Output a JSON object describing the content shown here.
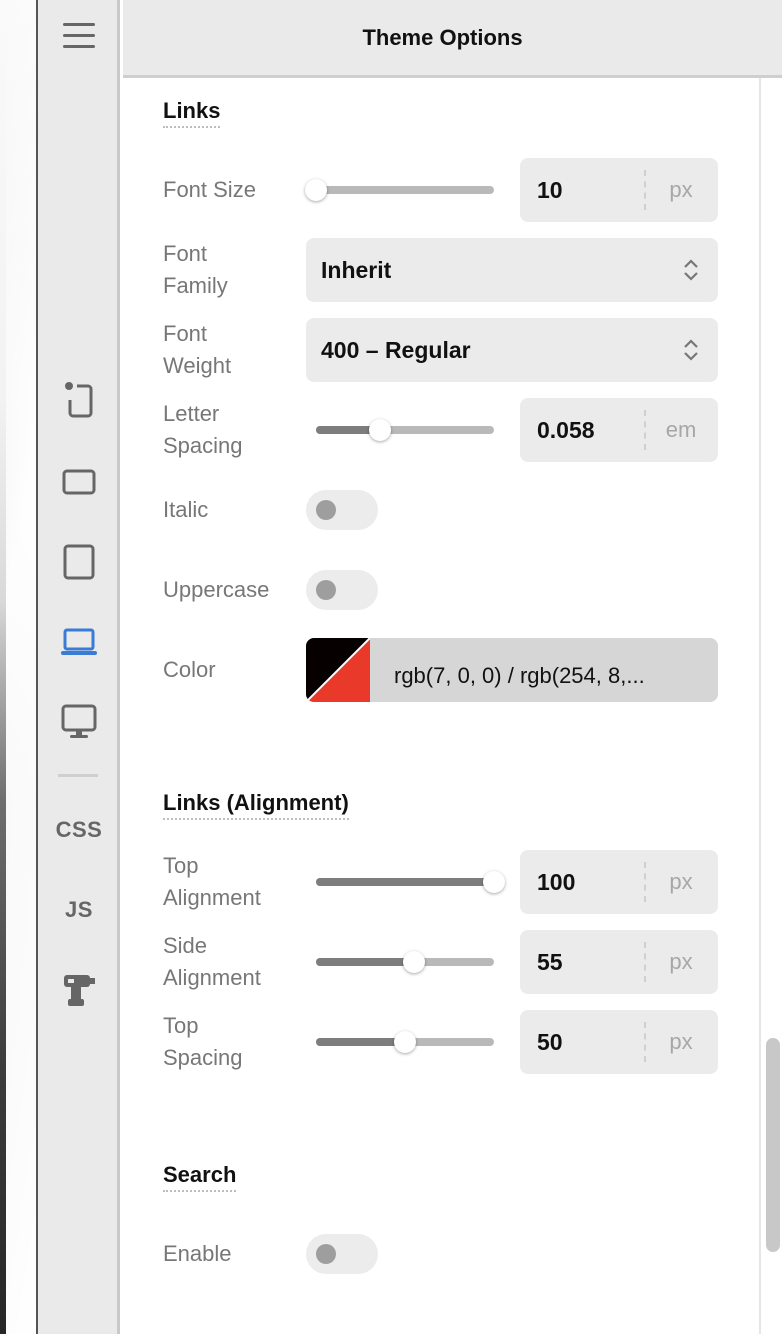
{
  "header": {
    "title": "Theme Options"
  },
  "rail": {
    "menu_icon": "hamburger-menu-icon",
    "items": [
      {
        "name": "mobile-portrait-icon"
      },
      {
        "name": "mobile-landscape-icon"
      },
      {
        "name": "tablet-icon"
      },
      {
        "name": "laptop-icon",
        "active": true
      },
      {
        "name": "desktop-icon"
      }
    ],
    "css_label": "CSS",
    "js_label": "JS",
    "tool_icon": "drill-icon",
    "active_color": "#3a7bd5"
  },
  "links": {
    "title": "Links",
    "font_size": {
      "label": "Font Size",
      "value": "10",
      "unit": "px",
      "level": 0
    },
    "font_family": {
      "label_1": "Font",
      "label_2": "Family",
      "value": "Inherit"
    },
    "font_weight": {
      "label_1": "Font",
      "label_2": "Weight",
      "value": "400 – Regular"
    },
    "letter_spacing": {
      "label_1": "Letter",
      "label_2": "Spacing",
      "value": "0.058",
      "unit": "em",
      "level": 0.36
    },
    "italic": {
      "label": "Italic",
      "on": false
    },
    "uppercase": {
      "label": "Uppercase",
      "on": false
    },
    "color": {
      "label": "Color",
      "value": "rgb(7, 0, 0) / rgb(254, 8,...",
      "swatch_a": "#070000",
      "swatch_b": "#e8392a"
    }
  },
  "alignment": {
    "title": "Links (Alignment)",
    "top_alignment": {
      "label_1": "Top",
      "label_2": "Alignment",
      "value": "100",
      "unit": "px",
      "level": 1.0
    },
    "side_alignment": {
      "label_1": "Side",
      "label_2": "Alignment",
      "value": "55",
      "unit": "px",
      "level": 0.55
    },
    "top_spacing": {
      "label_1": "Top",
      "label_2": "Spacing",
      "value": "50",
      "unit": "px",
      "level": 0.5
    }
  },
  "search": {
    "title": "Search",
    "enable": {
      "label": "Enable",
      "on": false
    }
  }
}
